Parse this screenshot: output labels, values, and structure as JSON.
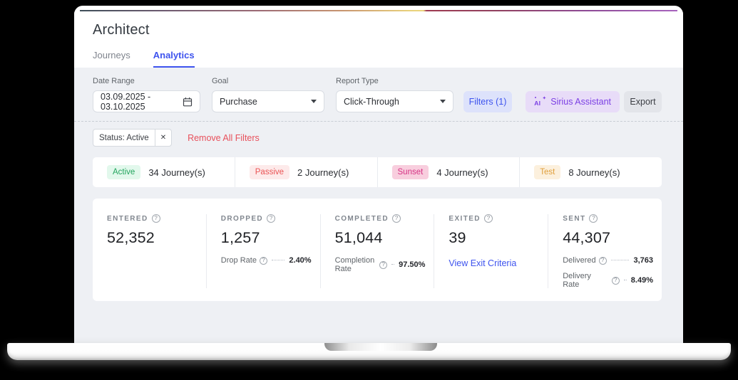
{
  "header": {
    "title": "Architect",
    "tabs": [
      {
        "label": "Journeys",
        "active": false
      },
      {
        "label": "Analytics",
        "active": true
      }
    ]
  },
  "filters": {
    "date_range": {
      "label": "Date Range",
      "value": "03.09.2025 - 03.10.2025"
    },
    "goal": {
      "label": "Goal",
      "value": "Purchase"
    },
    "report_type": {
      "label": "Report Type",
      "value": "Click-Through"
    },
    "filters_button": "Filters (1)",
    "sirius_button": "Sirius Assistant",
    "export_button": "Export"
  },
  "active_filters": {
    "chip": "Status: Active",
    "remove_all": "Remove All Filters"
  },
  "journey_summary": [
    {
      "status": "Active",
      "count": "34 Journey(s)",
      "badge_bg": "#e2f8ec",
      "badge_color": "#23a55e"
    },
    {
      "status": "Passive",
      "count": "2 Journey(s)",
      "badge_bg": "#fdeaea",
      "badge_color": "#ea5455"
    },
    {
      "status": "Sunset",
      "count": "4 Journey(s)",
      "badge_bg": "#f8cede",
      "badge_color": "#d63384"
    },
    {
      "status": "Test",
      "count": "8 Journey(s)",
      "badge_bg": "#fcf0dd",
      "badge_color": "#df9e3b"
    }
  ],
  "metric_cards": [
    {
      "label": "ENTERED",
      "value": "52,352"
    },
    {
      "label": "DROPPED",
      "value": "1,257",
      "rate_label": "Drop Rate",
      "rate_value": "2.40%"
    },
    {
      "label": "COMPLETED",
      "value": "51,044",
      "rate_label": "Completion Rate",
      "rate_value": "97.50%"
    },
    {
      "label": "EXITED",
      "value": "39",
      "link": "View Exit Criteria"
    },
    {
      "label": "SENT",
      "value": "44,307",
      "rows": [
        {
          "label": "Delivered",
          "value": "3,763"
        },
        {
          "label": "Delivery Rate",
          "value": "8.49%"
        }
      ]
    }
  ],
  "icons": {
    "help": "?",
    "close": "✕",
    "sparkle": "✦",
    "ai_text": "AI"
  },
  "colors": {
    "accent_blue": "#3d53ee",
    "danger_red": "#e8505b",
    "purple": "#7b3fe4",
    "content_bg": "#eef0f4"
  }
}
